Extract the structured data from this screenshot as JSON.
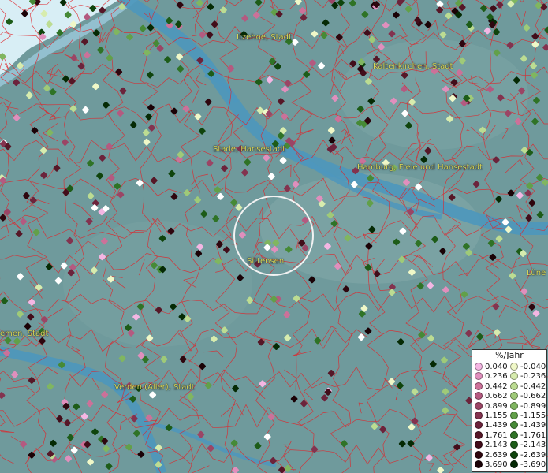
{
  "map": {
    "place_labels": [
      {
        "id": "itzehoe",
        "text": "Itzehoe, Stadt"
      },
      {
        "id": "kaltenkirchen",
        "text": "Kaltenkirchen, Stadt"
      },
      {
        "id": "stade",
        "text": "Stade, Hansestadt"
      },
      {
        "id": "hamburg",
        "text": "Hamburg, Freie und Hansestadt"
      },
      {
        "id": "sittensen",
        "text": "Sittensen"
      },
      {
        "id": "bremen",
        "text": "emen, Stadt"
      },
      {
        "id": "verden",
        "text": "Verden (Aller), Stadt"
      },
      {
        "id": "lueneburg",
        "text": "Lüne"
      }
    ],
    "colors": {
      "land": "#6f9a9c",
      "water": "#4d97bd",
      "sea": "#d8eef5",
      "boundaries": "#e0242a",
      "selection_circle": "#f2f2f2"
    }
  },
  "legend": {
    "title": "%/Jahr",
    "positive": [
      {
        "value": "0.040",
        "color": "#f4b6e3"
      },
      {
        "value": "0.236",
        "color": "#e08fbd"
      },
      {
        "value": "0.442",
        "color": "#cc7199"
      },
      {
        "value": "0.662",
        "color": "#b45a80"
      },
      {
        "value": "0.899",
        "color": "#9b4565"
      },
      {
        "value": "1.155",
        "color": "#83334f"
      },
      {
        "value": "1.439",
        "color": "#6c233b"
      },
      {
        "value": "1.761",
        "color": "#561727"
      },
      {
        "value": "2.143",
        "color": "#420d1a"
      },
      {
        "value": "2.639",
        "color": "#2e060e"
      },
      {
        "value": "3.690",
        "color": "#1a0206"
      }
    ],
    "negative": [
      {
        "value": "-0.040",
        "color": "#f0f8c8"
      },
      {
        "value": "-0.236",
        "color": "#d7ecae"
      },
      {
        "value": "-0.442",
        "color": "#bcdc92"
      },
      {
        "value": "-0.662",
        "color": "#9fca78"
      },
      {
        "value": "-0.899",
        "color": "#80b660"
      },
      {
        "value": "-1.155",
        "color": "#62a049"
      },
      {
        "value": "-1.439",
        "color": "#468a36"
      },
      {
        "value": "-1.761",
        "color": "#2f7326"
      },
      {
        "value": "-2.143",
        "color": "#1d5c18"
      },
      {
        "value": "-2.639",
        "color": "#0f440c"
      },
      {
        "value": "-3.690",
        "color": "#052a04"
      }
    ]
  }
}
